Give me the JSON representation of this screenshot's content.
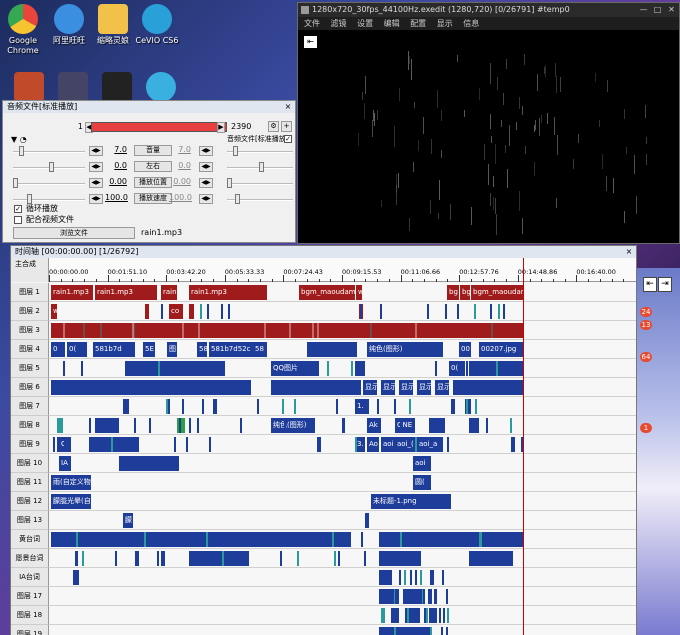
{
  "desktop": {
    "icons": [
      {
        "label": "Google Chrome",
        "color": "#e9453b"
      },
      {
        "label": "阿里旺旺",
        "color": "#3a8fe0"
      },
      {
        "label": "缩略灵娘",
        "color": "#f2c14a"
      },
      {
        "label": "CeVIO CS6",
        "color": "#2aa0d8"
      }
    ],
    "side_badges": [
      "24",
      "13",
      "64",
      "1"
    ]
  },
  "preview": {
    "title": "1280x720_30fps_44100Hz.exedit (1280,720)  [0/26791]  #temp0",
    "menu": [
      "文件",
      "滤镜",
      "设置",
      "编辑",
      "配置",
      "显示",
      "信息"
    ]
  },
  "audio": {
    "title": "音频文件[标准播放]",
    "frame_start": "1",
    "frame_end": "2390",
    "checkbox_label": "音频文件[标准播放]",
    "params": [
      {
        "value": "7.0",
        "button": "音量",
        "value2": "7.0"
      },
      {
        "value": "0.0",
        "button": "左右",
        "value2": "0.0"
      },
      {
        "value": "0.00",
        "button": "播放位置",
        "value2": "0.00"
      },
      {
        "value": "100.0",
        "button": "播放速度",
        "value2": "100.0"
      }
    ],
    "loop_label": "循环播放",
    "sync_label": "配合视频文件",
    "browse_label": "浏览文件",
    "filename": "rain1.mp3"
  },
  "timeline": {
    "title": "时间轴 [00:00:00.00] [1/26792]",
    "scene_label": "主合成",
    "ticks": [
      "00:00:00.00",
      "00:01:51.10",
      "00:03:42.20",
      "00:05:33.33",
      "00:07:24.43",
      "00:09:15.53",
      "00:11:06.66",
      "00:12:57.76",
      "00:14:48.86",
      "00:16:40.00"
    ],
    "layers": [
      "图层 1",
      "图层 2",
      "图层 3",
      "图层 4",
      "图层 5",
      "图层 6",
      "图层 7",
      "图层 8",
      "图层 9",
      "图层 10",
      "图层 11",
      "图层 12",
      "图层 13",
      "黄台词",
      "愿景台词",
      "IA台词",
      "图层 17",
      "图层 18",
      "图层 19"
    ],
    "labels": {
      "l1_a": "rain1.mp3",
      "l1_b": "rain1.mp3",
      "l1_c": "rain",
      "l1_d": "rain1.mp3",
      "l1_e": "bgm_maoudam",
      "l1_f": "w",
      "l1_g": "bg",
      "l1_h": "bg",
      "l1_i": "bgm_maoudar",
      "l2_a": "w",
      "l2_b": "co",
      "l4_a": "0",
      "l4_b": "0(",
      "l4_c": "581b7d",
      "l4_d": "5E",
      "l4_e": "图",
      "l4_f": "58",
      "l4_g": "581b7d52c",
      "l4_h": "58",
      "l4_i": "纯色(图形)",
      "l4_j": "00",
      "l4_k": "00207.jpg",
      "l5_a": "QQ图片",
      "l5_b": "0(",
      "l6_a": "显示",
      "l6_b": "显示",
      "l6_c": "显示",
      "l6_d": "显示",
      "l6_e": "显示",
      "l7_a": "1.",
      "l8_a": "纯色(图形)",
      "l8_b": "Ak",
      "l8_c": "ONE",
      "l9_a": "O",
      "l9_b": "3.",
      "l9_c": "Ao",
      "l9_d": "aoi",
      "l9_e": "aoi_(",
      "l9_f": "aoi_a",
      "l10_a": "IA",
      "l10_b": "aoi",
      "l11_a": "雨(自定义物",
      "l11_b": "圆(",
      "l12_a": "朦胧光晕(自定",
      "l12_b": "未标题-1.png",
      "l13_a": "朦"
    }
  }
}
